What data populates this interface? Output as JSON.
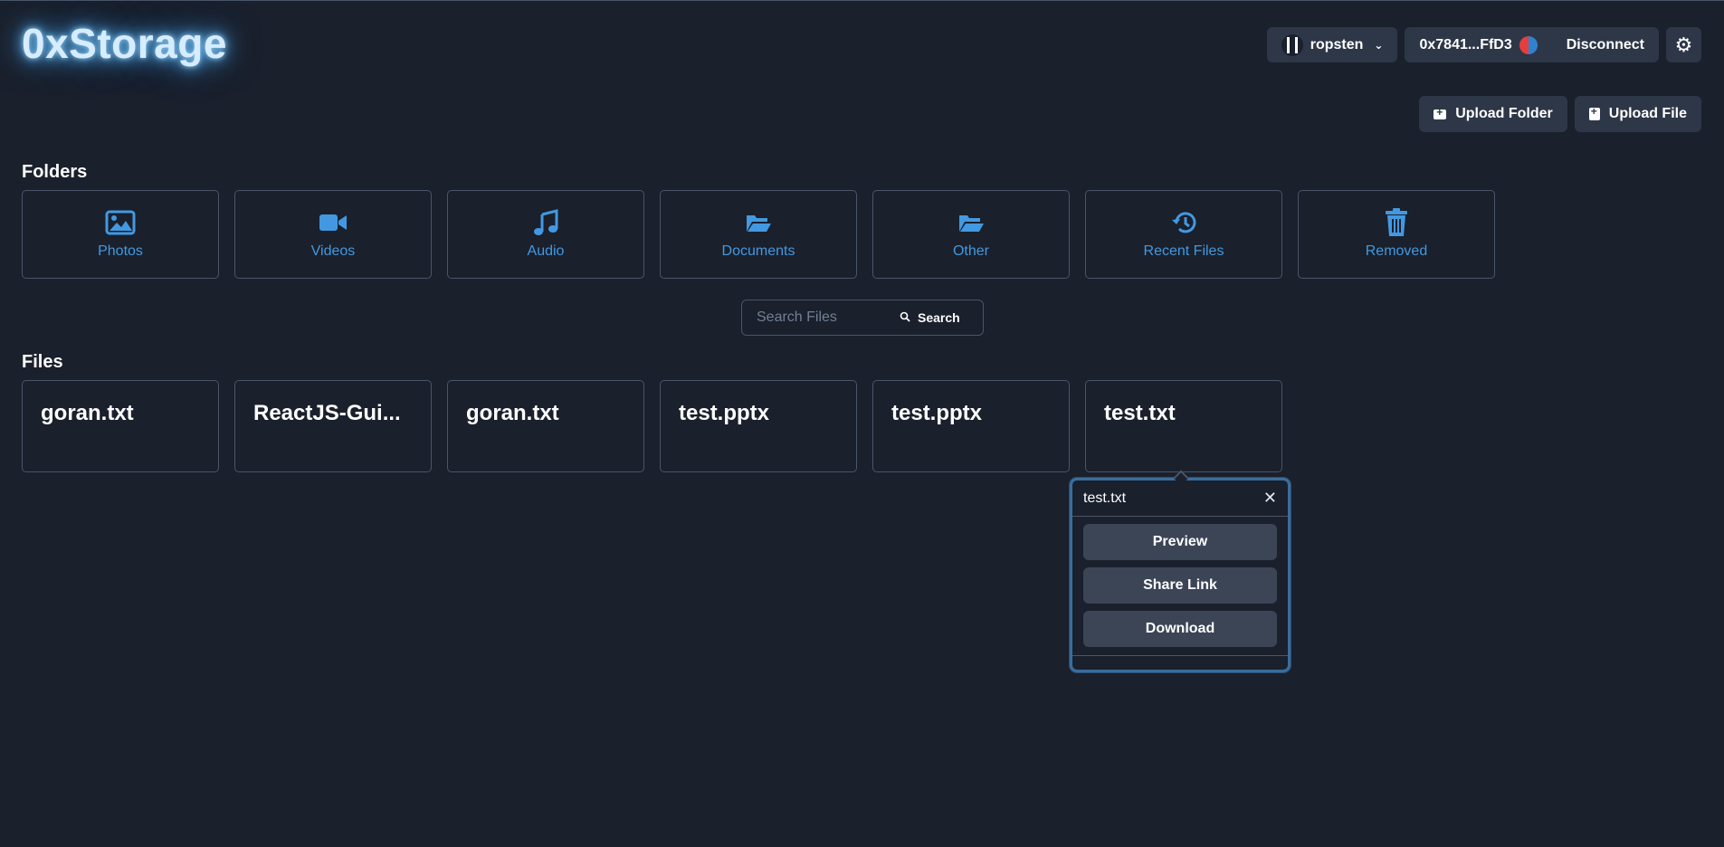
{
  "app": {
    "title": "0xStorage"
  },
  "header": {
    "network": "ropsten",
    "account": "0x7841...FfD3",
    "disconnect_label": "Disconnect"
  },
  "actions": {
    "upload_folder": "Upload Folder",
    "upload_file": "Upload File"
  },
  "folders": {
    "title": "Folders",
    "items": [
      {
        "label": "Photos",
        "icon": "image-icon"
      },
      {
        "label": "Videos",
        "icon": "video-icon"
      },
      {
        "label": "Audio",
        "icon": "music-icon"
      },
      {
        "label": "Documents",
        "icon": "folder-open-icon"
      },
      {
        "label": "Other",
        "icon": "folder-open-icon"
      },
      {
        "label": "Recent Files",
        "icon": "history-icon"
      },
      {
        "label": "Removed",
        "icon": "trash-icon"
      }
    ]
  },
  "search": {
    "placeholder": "Search Files",
    "button": "Search"
  },
  "files": {
    "title": "Files",
    "items": [
      "goran.txt",
      "ReactJS-Gui...",
      "goran.txt",
      "test.pptx",
      "test.pptx",
      "test.txt"
    ]
  },
  "popover": {
    "title": "test.txt",
    "preview": "Preview",
    "share": "Share Link",
    "download": "Download"
  },
  "colors": {
    "background": "#1a202c",
    "accent": "#4299e1",
    "panel": "#2d3748"
  }
}
